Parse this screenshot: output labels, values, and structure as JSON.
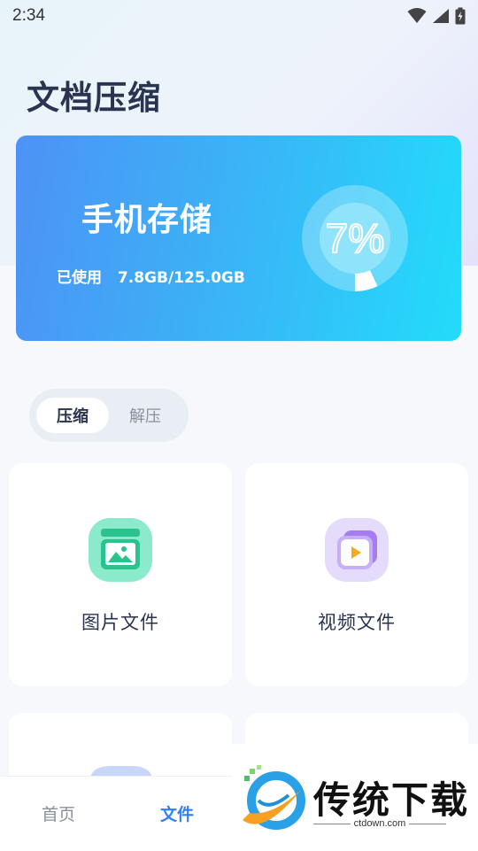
{
  "status_bar": {
    "time": "2:34"
  },
  "page": {
    "title": "文档压缩"
  },
  "storage": {
    "title": "手机存储",
    "used_label": "已使用",
    "used_value": "7.8GB/125.0GB",
    "percent_text": "7%",
    "percent": 0.07
  },
  "tabs": [
    {
      "label": "压缩",
      "active": true
    },
    {
      "label": "解压",
      "active": false
    }
  ],
  "categories": [
    {
      "label": "图片文件",
      "icon": "image-icon"
    },
    {
      "label": "视频文件",
      "icon": "video-icon"
    }
  ],
  "bottom_nav": [
    {
      "label": "首页",
      "active": false
    },
    {
      "label": "文件",
      "active": true
    }
  ],
  "colors": {
    "accent": "#2f7ff5",
    "card_start": "#4d92f5",
    "card_end": "#22dcfb",
    "title": "#2a3350"
  },
  "watermark": {
    "text": "传统下载",
    "url": "ctdown.com"
  }
}
